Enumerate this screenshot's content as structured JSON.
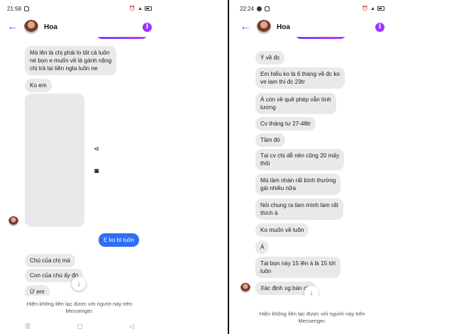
{
  "left": {
    "status": {
      "time": "21:58"
    },
    "header": {
      "contact_name": "Hoa"
    },
    "messages": [
      "Mà lên là chị phải lo tất cả luôn\nnè bọn e muốn về là gánh nặng\nchị trả lại tiền ngta luôn ne",
      "Ko em",
      "E ko bt luôn",
      "Chú của chị mà",
      "Con của chú ấy đó",
      "Ừ em"
    ],
    "footer": {
      "note_line1": "Hiện không liên lạc được với người này trên",
      "note_line2": "Messenger."
    },
    "nav": {
      "menu_glyph": "☰",
      "home_glyph": "▢",
      "back_glyph": "◁"
    }
  },
  "right": {
    "status": {
      "time": "22:24"
    },
    "header": {
      "contact_name": "Hoa"
    },
    "messages": [
      "Ý về đc",
      "Em hiểu ko là 6 tháng về đc ko\nve lam thì đc 23tr",
      "Á còn về quê phép vẫn tính\nlương",
      "Cv tháng tư 27-48tr",
      "Tầm đó",
      "Tại cv chị dễ nên cũng 20 mấy\nthôi",
      "Mà làm nhàn rất bình thường\ngái nhiều nữa",
      "Nói chung ra tien mình làm rất\nthích á",
      "Ko muốn về luôn",
      "Á",
      "Tại bọn này 15 lên á là 15 tới\nluôn",
      "Xác định xg bán chị"
    ],
    "footer": {
      "note_line1": "Hiện không liên lạc được với người này trên",
      "note_line2": "Messenger."
    }
  },
  "colors": {
    "accent_purple": "#a033ff",
    "sent_blue": "#2f6df6",
    "received_gray": "#e9e9eb"
  }
}
